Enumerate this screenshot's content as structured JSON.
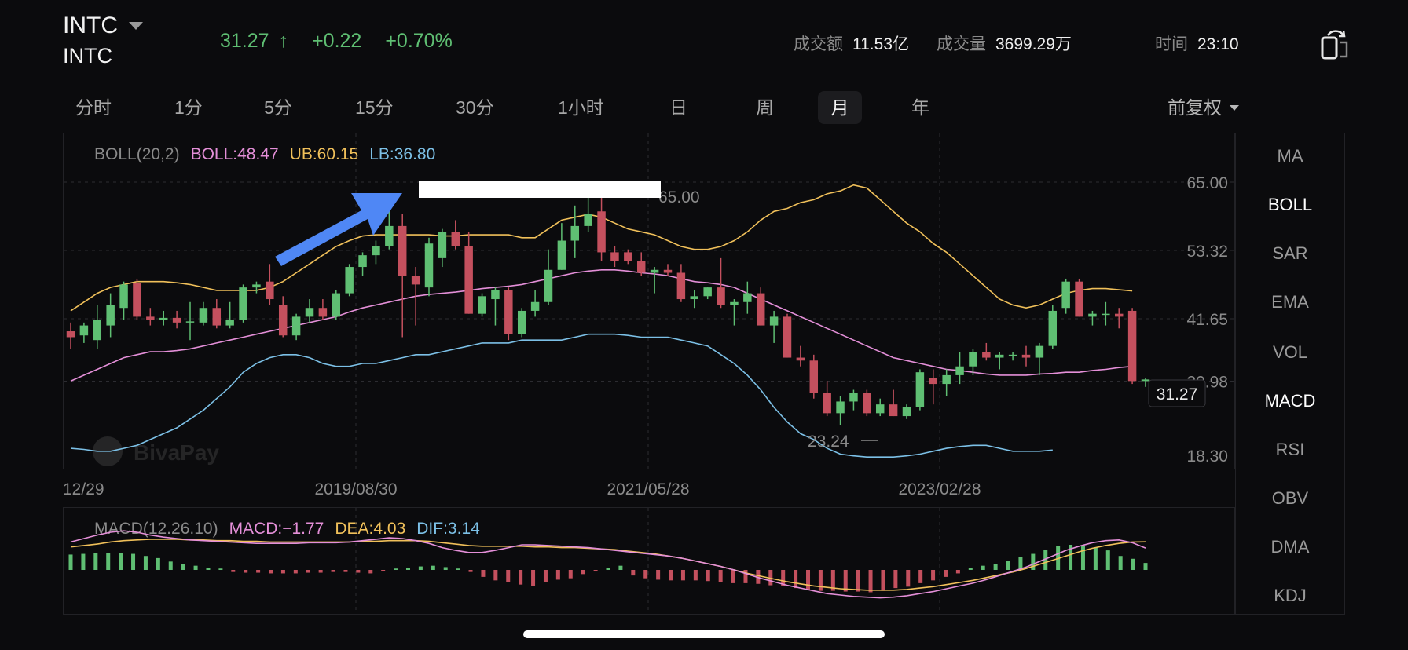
{
  "header": {
    "symbol": "INTC",
    "symbol_sub": "INTC",
    "price": "31.27",
    "change": "+0.22",
    "change_pct": "+0.70%",
    "turnover_label": "成交额",
    "turnover": "11.53亿",
    "volume_label": "成交量",
    "volume": "3699.29万",
    "time_label": "时间",
    "time": "23:10",
    "up_color": "#5fbf73",
    "down_color": "#c4505e"
  },
  "tabs": [
    "分时",
    "1分",
    "5分",
    "15分",
    "30分",
    "1小时",
    "日",
    "周",
    "月",
    "年"
  ],
  "active_tab": "月",
  "adjust": "前复权",
  "boll_legend": {
    "name": "BOLL(20,2)",
    "boll": "BOLL:48.47",
    "ub": "UB:60.15",
    "lb": "LB:36.80"
  },
  "macd_legend": {
    "name": "MACD(12.26.10)",
    "macd": "MACD:−1.77",
    "dea": "DEA:4.03",
    "dif": "DIF:3.14"
  },
  "indicators": [
    "MA",
    "BOLL",
    "SAR",
    "EMA",
    "VOL",
    "MACD",
    "RSI",
    "OBV",
    "DMA",
    "KDJ"
  ],
  "active_indicators": [
    "BOLL",
    "MACD"
  ],
  "chart_data": {
    "type": "candlestick",
    "y_ticks": [
      "65.00",
      "53.32",
      "41.65",
      "30.98",
      "18.30"
    ],
    "x_ticks": [
      "12/29",
      "2019/08/30",
      "2021/05/28",
      "2023/02/28"
    ],
    "ylim": [
      18.3,
      65.0
    ],
    "high_label": "65.00",
    "low_label": "23.24",
    "last_price_label": "31.27",
    "watermark": "BivaPay",
    "candles": [
      {
        "o": 39.5,
        "h": 41.0,
        "l": 36.5,
        "c": 38.5
      },
      {
        "o": 38.8,
        "h": 41.0,
        "l": 37.5,
        "c": 40.5
      },
      {
        "o": 38.0,
        "h": 44.0,
        "l": 36.5,
        "c": 41.5
      },
      {
        "o": 40.5,
        "h": 46.0,
        "l": 38.5,
        "c": 44.0
      },
      {
        "o": 43.5,
        "h": 48.0,
        "l": 41.5,
        "c": 47.5
      },
      {
        "o": 47.8,
        "h": 48.5,
        "l": 41.5,
        "c": 42.0
      },
      {
        "o": 42.0,
        "h": 43.5,
        "l": 40.5,
        "c": 41.5
      },
      {
        "o": 41.5,
        "h": 43.0,
        "l": 40.5,
        "c": 41.8
      },
      {
        "o": 41.8,
        "h": 43.0,
        "l": 40.0,
        "c": 41.0
      },
      {
        "o": 41.0,
        "h": 44.5,
        "l": 38.0,
        "c": 41.2
      },
      {
        "o": 41.0,
        "h": 44.5,
        "l": 40.5,
        "c": 43.5
      },
      {
        "o": 43.5,
        "h": 45.0,
        "l": 40.0,
        "c": 40.5
      },
      {
        "o": 40.5,
        "h": 44.5,
        "l": 40.0,
        "c": 41.5
      },
      {
        "o": 41.5,
        "h": 47.5,
        "l": 41.0,
        "c": 47.0
      },
      {
        "o": 47.0,
        "h": 48.0,
        "l": 46.0,
        "c": 47.5
      },
      {
        "o": 48.0,
        "h": 51.0,
        "l": 44.0,
        "c": 45.0
      },
      {
        "o": 44.0,
        "h": 45.5,
        "l": 38.5,
        "c": 38.8
      },
      {
        "o": 38.8,
        "h": 42.5,
        "l": 38.0,
        "c": 42.0
      },
      {
        "o": 42.0,
        "h": 45.0,
        "l": 41.0,
        "c": 43.5
      },
      {
        "o": 43.5,
        "h": 45.0,
        "l": 41.5,
        "c": 42.0
      },
      {
        "o": 42.0,
        "h": 46.5,
        "l": 41.5,
        "c": 46.0
      },
      {
        "o": 46.0,
        "h": 51.0,
        "l": 45.5,
        "c": 50.5
      },
      {
        "o": 50.5,
        "h": 53.0,
        "l": 49.0,
        "c": 52.5
      },
      {
        "o": 52.5,
        "h": 55.0,
        "l": 51.0,
        "c": 54.0
      },
      {
        "o": 54.0,
        "h": 60.0,
        "l": 53.5,
        "c": 57.5
      },
      {
        "o": 57.5,
        "h": 59.5,
        "l": 38.5,
        "c": 49.0
      },
      {
        "o": 49.0,
        "h": 50.5,
        "l": 40.5,
        "c": 47.5
      },
      {
        "o": 47.0,
        "h": 55.5,
        "l": 45.5,
        "c": 54.5
      },
      {
        "o": 52.0,
        "h": 57.0,
        "l": 50.5,
        "c": 56.5
      },
      {
        "o": 56.5,
        "h": 58.5,
        "l": 53.5,
        "c": 54.0
      },
      {
        "o": 54.0,
        "h": 56.5,
        "l": 42.5,
        "c": 42.5
      },
      {
        "o": 42.5,
        "h": 46.0,
        "l": 42.0,
        "c": 45.5
      },
      {
        "o": 45.0,
        "h": 47.0,
        "l": 40.5,
        "c": 46.5
      },
      {
        "o": 46.5,
        "h": 47.0,
        "l": 38.0,
        "c": 39.0
      },
      {
        "o": 39.0,
        "h": 43.5,
        "l": 38.5,
        "c": 43.0
      },
      {
        "o": 43.0,
        "h": 46.5,
        "l": 42.0,
        "c": 44.5
      },
      {
        "o": 44.5,
        "h": 53.5,
        "l": 44.0,
        "c": 50.0
      },
      {
        "o": 50.0,
        "h": 58.0,
        "l": 50.0,
        "c": 55.0
      },
      {
        "o": 55.0,
        "h": 61.0,
        "l": 52.0,
        "c": 57.5
      },
      {
        "o": 57.5,
        "h": 62.5,
        "l": 56.5,
        "c": 59.5
      },
      {
        "o": 60.0,
        "h": 65.0,
        "l": 51.5,
        "c": 53.0
      },
      {
        "o": 53.0,
        "h": 54.0,
        "l": 50.5,
        "c": 51.5
      },
      {
        "o": 53.0,
        "h": 53.5,
        "l": 51.0,
        "c": 51.5
      },
      {
        "o": 51.5,
        "h": 53.0,
        "l": 49.0,
        "c": 49.5
      },
      {
        "o": 49.5,
        "h": 50.5,
        "l": 46.0,
        "c": 50.0
      },
      {
        "o": 50.0,
        "h": 51.0,
        "l": 49.0,
        "c": 49.5
      },
      {
        "o": 49.5,
        "h": 51.0,
        "l": 44.5,
        "c": 45.0
      },
      {
        "o": 45.0,
        "h": 46.5,
        "l": 43.5,
        "c": 45.5
      },
      {
        "o": 45.5,
        "h": 47.0,
        "l": 45.0,
        "c": 47.0
      },
      {
        "o": 47.0,
        "h": 52.0,
        "l": 43.5,
        "c": 44.0
      },
      {
        "o": 44.0,
        "h": 45.0,
        "l": 40.5,
        "c": 44.5
      },
      {
        "o": 44.5,
        "h": 48.0,
        "l": 42.5,
        "c": 46.0
      },
      {
        "o": 46.0,
        "h": 47.0,
        "l": 40.5,
        "c": 40.5
      },
      {
        "o": 40.5,
        "h": 43.0,
        "l": 37.5,
        "c": 42.0
      },
      {
        "o": 42.0,
        "h": 42.5,
        "l": 35.0,
        "c": 35.0
      },
      {
        "o": 35.0,
        "h": 37.0,
        "l": 33.5,
        "c": 34.5
      },
      {
        "o": 34.5,
        "h": 35.5,
        "l": 28.0,
        "c": 29.0
      },
      {
        "o": 29.0,
        "h": 31.0,
        "l": 25.0,
        "c": 25.5
      },
      {
        "o": 25.5,
        "h": 28.5,
        "l": 23.5,
        "c": 27.5
      },
      {
        "o": 27.5,
        "h": 29.5,
        "l": 26.0,
        "c": 29.0
      },
      {
        "o": 29.0,
        "h": 29.5,
        "l": 25.0,
        "c": 25.5
      },
      {
        "o": 25.5,
        "h": 28.0,
        "l": 25.0,
        "c": 27.0
      },
      {
        "o": 27.0,
        "h": 29.5,
        "l": 25.0,
        "c": 25.0
      },
      {
        "o": 25.0,
        "h": 27.0,
        "l": 24.5,
        "c": 26.5
      },
      {
        "o": 26.5,
        "h": 33.0,
        "l": 26.0,
        "c": 32.5
      },
      {
        "o": 31.5,
        "h": 33.0,
        "l": 27.0,
        "c": 30.5
      },
      {
        "o": 30.5,
        "h": 33.0,
        "l": 28.5,
        "c": 32.0
      },
      {
        "o": 32.0,
        "h": 36.0,
        "l": 30.5,
        "c": 33.5
      },
      {
        "o": 33.5,
        "h": 36.5,
        "l": 32.0,
        "c": 36.0
      },
      {
        "o": 36.0,
        "h": 37.5,
        "l": 34.5,
        "c": 35.0
      },
      {
        "o": 35.0,
        "h": 36.0,
        "l": 33.0,
        "c": 35.5
      },
      {
        "o": 35.5,
        "h": 36.0,
        "l": 34.5,
        "c": 35.5
      },
      {
        "o": 35.5,
        "h": 37.0,
        "l": 33.5,
        "c": 35.0
      },
      {
        "o": 35.0,
        "h": 37.5,
        "l": 32.0,
        "c": 37.0
      },
      {
        "o": 37.0,
        "h": 44.0,
        "l": 36.5,
        "c": 43.0
      },
      {
        "o": 43.5,
        "h": 48.5,
        "l": 42.5,
        "c": 48.0
      },
      {
        "o": 48.0,
        "h": 48.5,
        "l": 42.0,
        "c": 42.0
      },
      {
        "o": 42.0,
        "h": 43.0,
        "l": 40.5,
        "c": 42.5
      },
      {
        "o": 42.5,
        "h": 44.5,
        "l": 40.5,
        "c": 42.5
      },
      {
        "o": 42.5,
        "h": 43.5,
        "l": 40.0,
        "c": 42.0
      },
      {
        "o": 43.0,
        "h": 43.5,
        "l": 30.5,
        "c": 31.0
      },
      {
        "o": 31.0,
        "h": 31.5,
        "l": 30.0,
        "c": 31.27
      }
    ],
    "ub": [
      43.0,
      44.5,
      46.0,
      47.0,
      47.5,
      48.0,
      48.0,
      48.0,
      47.8,
      47.5,
      47.0,
      46.5,
      46.5,
      46.5,
      46.5,
      47.0,
      48.0,
      49.5,
      51.0,
      52.5,
      54.0,
      55.0,
      55.8,
      56.0,
      56.0,
      56.0,
      56.0,
      56.0,
      55.8,
      55.8,
      56.0,
      56.0,
      56.0,
      56.0,
      55.5,
      55.5,
      57.0,
      58.5,
      59.0,
      59.5,
      59.0,
      58.0,
      57.0,
      56.5,
      56.0,
      55.0,
      54.0,
      53.5,
      53.5,
      54.0,
      55.0,
      56.5,
      58.5,
      60.0,
      60.5,
      61.5,
      62.0,
      63.0,
      63.5,
      64.5,
      64.0,
      62.0,
      60.0,
      58.0,
      56.5,
      54.5,
      53.0,
      51.0,
      49.0,
      47.0,
      45.0,
      44.0,
      43.5,
      44.0,
      45.0,
      46.0,
      46.5,
      46.8,
      46.8,
      46.6,
      46.4
    ],
    "boll": [
      31.0,
      32.0,
      33.0,
      34.0,
      35.0,
      35.5,
      36.0,
      36.0,
      36.2,
      36.5,
      37.0,
      37.5,
      38.0,
      38.5,
      39.0,
      39.5,
      40.0,
      40.5,
      41.0,
      41.5,
      42.0,
      42.8,
      43.5,
      44.0,
      44.5,
      45.0,
      45.5,
      45.8,
      46.0,
      46.2,
      46.5,
      46.8,
      47.0,
      47.2,
      47.5,
      48.0,
      48.5,
      49.0,
      49.5,
      49.8,
      50.0,
      50.0,
      49.8,
      49.5,
      49.3,
      49.0,
      48.5,
      48.0,
      47.8,
      47.5,
      47.0,
      46.0,
      45.0,
      44.0,
      43.0,
      42.0,
      41.0,
      40.0,
      39.0,
      38.0,
      37.0,
      36.0,
      35.0,
      34.5,
      34.0,
      33.5,
      33.0,
      32.8,
      32.5,
      32.2,
      32.0,
      32.0,
      32.0,
      32.2,
      32.3,
      32.5,
      32.5,
      32.8,
      33.0,
      33.3,
      33.5
    ],
    "lb": [
      19.5,
      19.3,
      19.0,
      19.0,
      19.5,
      20.0,
      21.0,
      22.0,
      23.0,
      24.5,
      26.0,
      28.0,
      30.0,
      32.5,
      34.0,
      35.0,
      35.5,
      35.5,
      35.0,
      34.0,
      33.5,
      33.5,
      34.0,
      34.0,
      34.5,
      35.0,
      35.5,
      35.5,
      36.0,
      36.5,
      37.0,
      37.5,
      37.5,
      37.5,
      38.0,
      38.0,
      38.0,
      38.0,
      38.5,
      39.0,
      39.0,
      39.0,
      38.8,
      38.5,
      38.5,
      38.5,
      38.0,
      37.5,
      37.0,
      35.5,
      34.0,
      32.0,
      29.5,
      26.5,
      24.0,
      22.0,
      21.0,
      19.5,
      18.5,
      18.2,
      18.0,
      18.0,
      18.0,
      18.2,
      18.5,
      19.0,
      19.5,
      19.8,
      20.0,
      20.0,
      19.5,
      19.0,
      19.0,
      19.0,
      19.2
    ]
  },
  "macd_data": {
    "type": "bar",
    "hist": [
      2.2,
      2.3,
      2.4,
      2.4,
      2.4,
      2.3,
      2.0,
      1.7,
      1.2,
      0.9,
      0.6,
      0.3,
      0.2,
      -0.3,
      -0.4,
      -0.4,
      -0.5,
      -0.5,
      -0.5,
      -0.4,
      -0.4,
      -0.3,
      -0.3,
      -0.4,
      -0.5,
      -0.2,
      0.2,
      0.3,
      0.5,
      0.6,
      0.4,
      0.2,
      -0.3,
      -1.0,
      -1.5,
      -1.8,
      -2.1,
      -2.3,
      -1.8,
      -1.4,
      -1.2,
      -0.6,
      -0.2,
      0.3,
      0.6,
      -0.8,
      -1.2,
      -1.4,
      -1.5,
      -1.5,
      -1.5,
      -1.6,
      -1.8,
      -1.9,
      -1.9,
      -2.0,
      -2.2,
      -2.3,
      -2.6,
      -2.8,
      -3.0,
      -3.0,
      -3.1,
      -3.1,
      -3.2,
      -3.0,
      -2.6,
      -2.4,
      -1.9,
      -1.5,
      -1.0,
      -0.5,
      0.3,
      0.6,
      0.9,
      1.3,
      1.8,
      2.3,
      2.9,
      3.4,
      3.6,
      3.5,
      3.2,
      2.8,
      2.0,
      1.6,
      1.0
    ],
    "dif": [
      4.0,
      4.5,
      5.0,
      5.4,
      5.6,
      5.4,
      5.0,
      4.7,
      4.5,
      4.3,
      4.2,
      4.1,
      4.0,
      3.9,
      3.8,
      3.8,
      3.8,
      3.8,
      3.9,
      3.9,
      3.9,
      4.0,
      4.2,
      4.4,
      4.6,
      4.5,
      4.2,
      3.8,
      3.2,
      2.8,
      2.5,
      2.5,
      2.8,
      3.2,
      3.6,
      3.6,
      3.5,
      3.4,
      3.3,
      3.2,
      3.0,
      2.8,
      2.6,
      2.4,
      2.2,
      2.0,
      1.7,
      1.3,
      0.9,
      0.5,
      0.0,
      -0.6,
      -1.2,
      -1.7,
      -2.2,
      -2.6,
      -3.0,
      -3.4,
      -3.6,
      -3.8,
      -3.9,
      -4.0,
      -3.9,
      -3.7,
      -3.4,
      -3.1,
      -2.7,
      -2.3,
      -1.9,
      -1.4,
      -0.8,
      -0.2,
      0.4,
      1.2,
      2.0,
      2.8,
      3.4,
      3.9,
      4.2,
      4.3,
      3.9,
      3.14
    ],
    "dea": [
      3.3,
      3.5,
      3.7,
      4.0,
      4.2,
      4.3,
      4.4,
      4.4,
      4.4,
      4.3,
      4.3,
      4.2,
      4.2,
      4.1,
      4.1,
      4.0,
      4.0,
      4.0,
      4.0,
      4.0,
      4.0,
      4.0,
      4.1,
      4.1,
      4.2,
      4.2,
      4.2,
      4.1,
      3.9,
      3.7,
      3.5,
      3.4,
      3.4,
      3.4,
      3.4,
      3.3,
      3.3,
      3.2,
      3.2,
      3.1,
      3.0,
      2.9,
      2.7,
      2.5,
      2.3,
      2.0,
      1.7,
      1.3,
      0.9,
      0.5,
      0.0,
      -0.5,
      -0.9,
      -1.3,
      -1.7,
      -2.0,
      -2.3,
      -2.5,
      -2.7,
      -2.8,
      -2.9,
      -2.9,
      -2.9,
      -2.8,
      -2.6,
      -2.4,
      -2.1,
      -1.8,
      -1.5,
      -1.1,
      -0.7,
      -0.3,
      0.2,
      0.8,
      1.4,
      2.0,
      2.6,
      3.1,
      3.5,
      3.8,
      4.0,
      4.03
    ]
  }
}
